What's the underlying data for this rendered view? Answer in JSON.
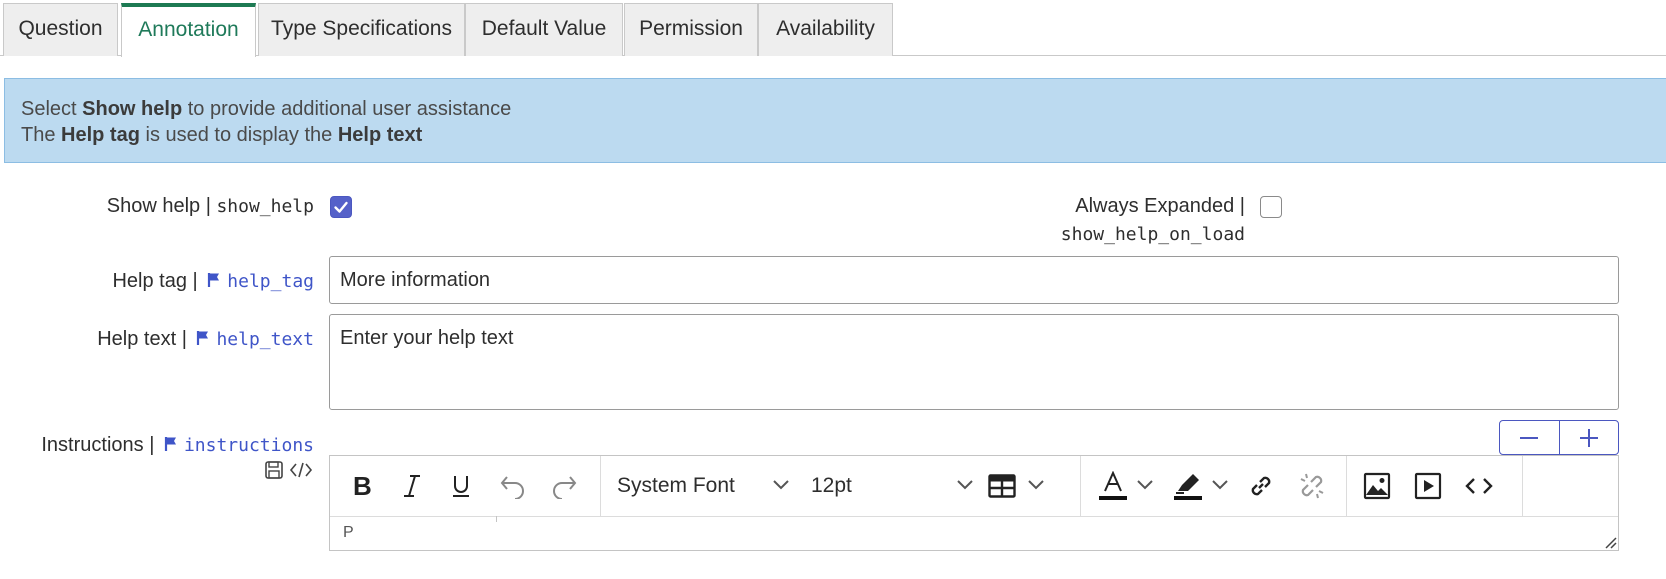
{
  "tabs": [
    "Question",
    "Annotation",
    "Type Specifications",
    "Default Value",
    "Permission",
    "Availability"
  ],
  "banner": {
    "line1_pre": "Select ",
    "line1_bold": "Show help",
    "line1_post": " to provide additional user assistance",
    "line2_pre": "The ",
    "line2_bold1": "Help tag",
    "line2_mid": " is used to display the ",
    "line2_bold2": "Help text"
  },
  "fields": {
    "show_help": {
      "label": "Show help",
      "sep": " | ",
      "name": "show_help",
      "checked": true
    },
    "always_expanded": {
      "label": "Always Expanded",
      "sep": " |",
      "name": "show_help_on_load",
      "checked": false
    },
    "help_tag": {
      "label": "Help tag",
      "sep": " | ",
      "name": "help_tag",
      "value": "More information"
    },
    "help_text": {
      "label": "Help text",
      "sep": " | ",
      "name": "help_text",
      "value": "Enter your help text"
    },
    "instructions": {
      "label": "Instructions",
      "sep": " | ",
      "name": "instructions"
    }
  },
  "editor": {
    "font_family": "System Font",
    "font_size": "12pt",
    "path": "P"
  },
  "colors": {
    "accent": "#5561c9",
    "active_tab": "#1d7a53",
    "banner_bg": "#bcdaf0",
    "field_name_blue": "#3f55c8"
  }
}
